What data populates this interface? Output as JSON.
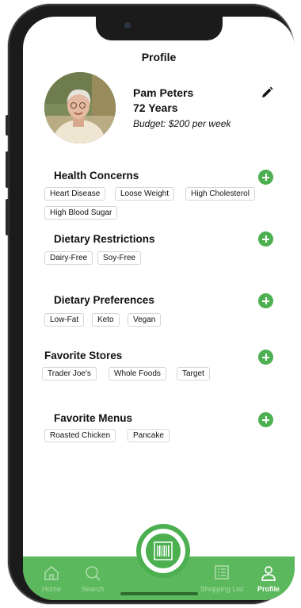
{
  "header": {
    "title": "Profile"
  },
  "profile": {
    "name": "Pam Peters",
    "age": "72 Years",
    "budget": "Budget: $200 per week"
  },
  "sections": [
    {
      "title": "Health Concerns",
      "tags": [
        "Heart Disease",
        "Loose Weight",
        "High Cholesterol",
        "High Blood Sugar"
      ]
    },
    {
      "title": "Dietary Restrictions",
      "tags": [
        "Dairy-Free",
        "Soy-Free"
      ]
    },
    {
      "title": "Dietary Preferences",
      "tags": [
        "Low-Fat",
        "Keto",
        "Vegan"
      ]
    },
    {
      "title": "Favorite Stores",
      "tags": [
        "Trader Joe's",
        "Whole Foods",
        "Target"
      ]
    },
    {
      "title": "Favorite Menus",
      "tags": [
        "Roasted Chicken",
        "Pancake"
      ]
    }
  ],
  "nav": {
    "items": [
      {
        "label": "Home",
        "icon": "home-icon"
      },
      {
        "label": "Search",
        "icon": "search-icon"
      },
      {
        "label": "Shopping List",
        "icon": "list-icon"
      },
      {
        "label": "Profile",
        "icon": "user-icon"
      }
    ],
    "active": "Profile",
    "scan_icon": "barcode-icon"
  },
  "colors": {
    "accent": "#4caf50",
    "navbar": "#5cb85c",
    "nav_inactive_label": "#a9dca9"
  }
}
